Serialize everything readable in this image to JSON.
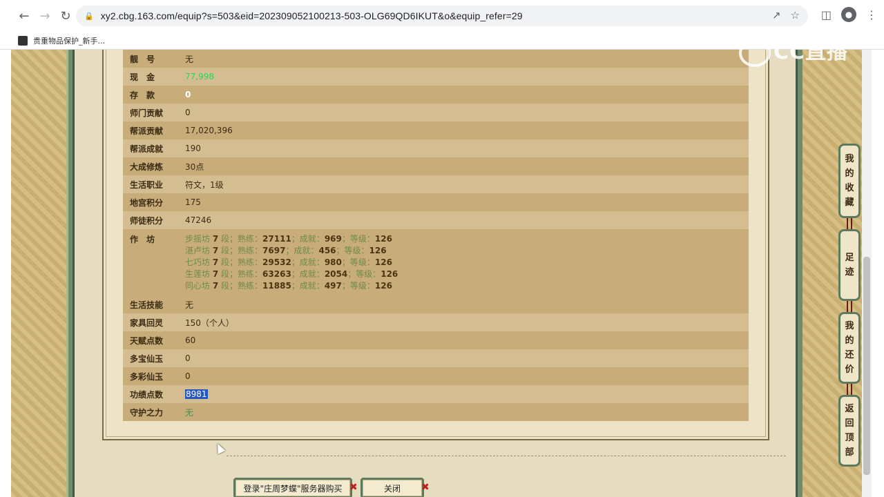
{
  "browser": {
    "url": "xy2.cbg.163.com/equip?s=503&eid=202309052100213-503-OLG69QD6IKUT&o&equip_refer=29",
    "bookmark_label": "贵重物品保护_新手..."
  },
  "rows": [
    {
      "label": "靓　号",
      "value": "无",
      "style": "normal"
    },
    {
      "label": "现　金",
      "value": "77,998",
      "style": "green"
    },
    {
      "label": "存　款",
      "value": "0",
      "style": "white"
    },
    {
      "label": "师门贡献",
      "value": "0",
      "style": "normal"
    },
    {
      "label": "帮派贡献",
      "value": "17,020,396",
      "style": "normal"
    },
    {
      "label": "帮派成就",
      "value": "190",
      "style": "normal"
    },
    {
      "label": "大成修炼",
      "value": "30点",
      "style": "normal"
    },
    {
      "label": "生活职业",
      "value": "符文，1级",
      "style": "normal"
    },
    {
      "label": "地宫积分",
      "value": "175",
      "style": "normal"
    },
    {
      "label": "师徒积分",
      "value": "47246",
      "style": "normal"
    }
  ],
  "workshop": {
    "label": "作　坊",
    "lines": [
      {
        "name": "步摇坊",
        "level": "7",
        "seg": "段；熟练：",
        "proficiency": "27111",
        "ach_label": "；成就：",
        "achievement": "969",
        "grade_label": "；等级：",
        "grade": "126"
      },
      {
        "name": "湛卢坊",
        "level": "7",
        "seg": "段；熟练：",
        "proficiency": "7697",
        "ach_label": "；成就：",
        "achievement": "456",
        "grade_label": "；等级：",
        "grade": "126"
      },
      {
        "name": "七巧坊",
        "level": "7",
        "seg": "段；熟练：",
        "proficiency": "29532",
        "ach_label": "；成就：",
        "achievement": "980",
        "grade_label": "；等级：",
        "grade": "126"
      },
      {
        "name": "生莲坊",
        "level": "7",
        "seg": "段；熟练：",
        "proficiency": "63263",
        "ach_label": "；成就：",
        "achievement": "2054",
        "grade_label": "；等级：",
        "grade": "126"
      },
      {
        "name": "同心坊",
        "level": "7",
        "seg": "段；熟练：",
        "proficiency": "11885",
        "ach_label": "；成就：",
        "achievement": "497",
        "grade_label": "；等级：",
        "grade": "126"
      }
    ]
  },
  "rows2": [
    {
      "label": "生活技能",
      "value": "无",
      "style": "normal"
    },
    {
      "label": "家具回灵",
      "value": "150（个人）",
      "style": "normal"
    },
    {
      "label": "天赋点数",
      "value": "60",
      "style": "normal"
    },
    {
      "label": "多宝仙玉",
      "value": "0",
      "style": "normal"
    },
    {
      "label": "多彩仙玉",
      "value": "0",
      "style": "normal"
    },
    {
      "label": "功绩点数",
      "value": "8981",
      "style": "selected"
    },
    {
      "label": "守护之力",
      "value": "无",
      "style": "dimgreen"
    }
  ],
  "buttons": {
    "login": "登录\"庄周梦蝶\"服务器购买",
    "close": "关闭"
  },
  "side_nav": {
    "favorites": [
      "我",
      "的",
      "收",
      "藏"
    ],
    "footprint": [
      "足",
      "迹"
    ],
    "bargain": [
      "我",
      "的",
      "还",
      "价"
    ],
    "top": [
      "返",
      "回",
      "顶",
      "部"
    ]
  },
  "watermark": "CC直播"
}
